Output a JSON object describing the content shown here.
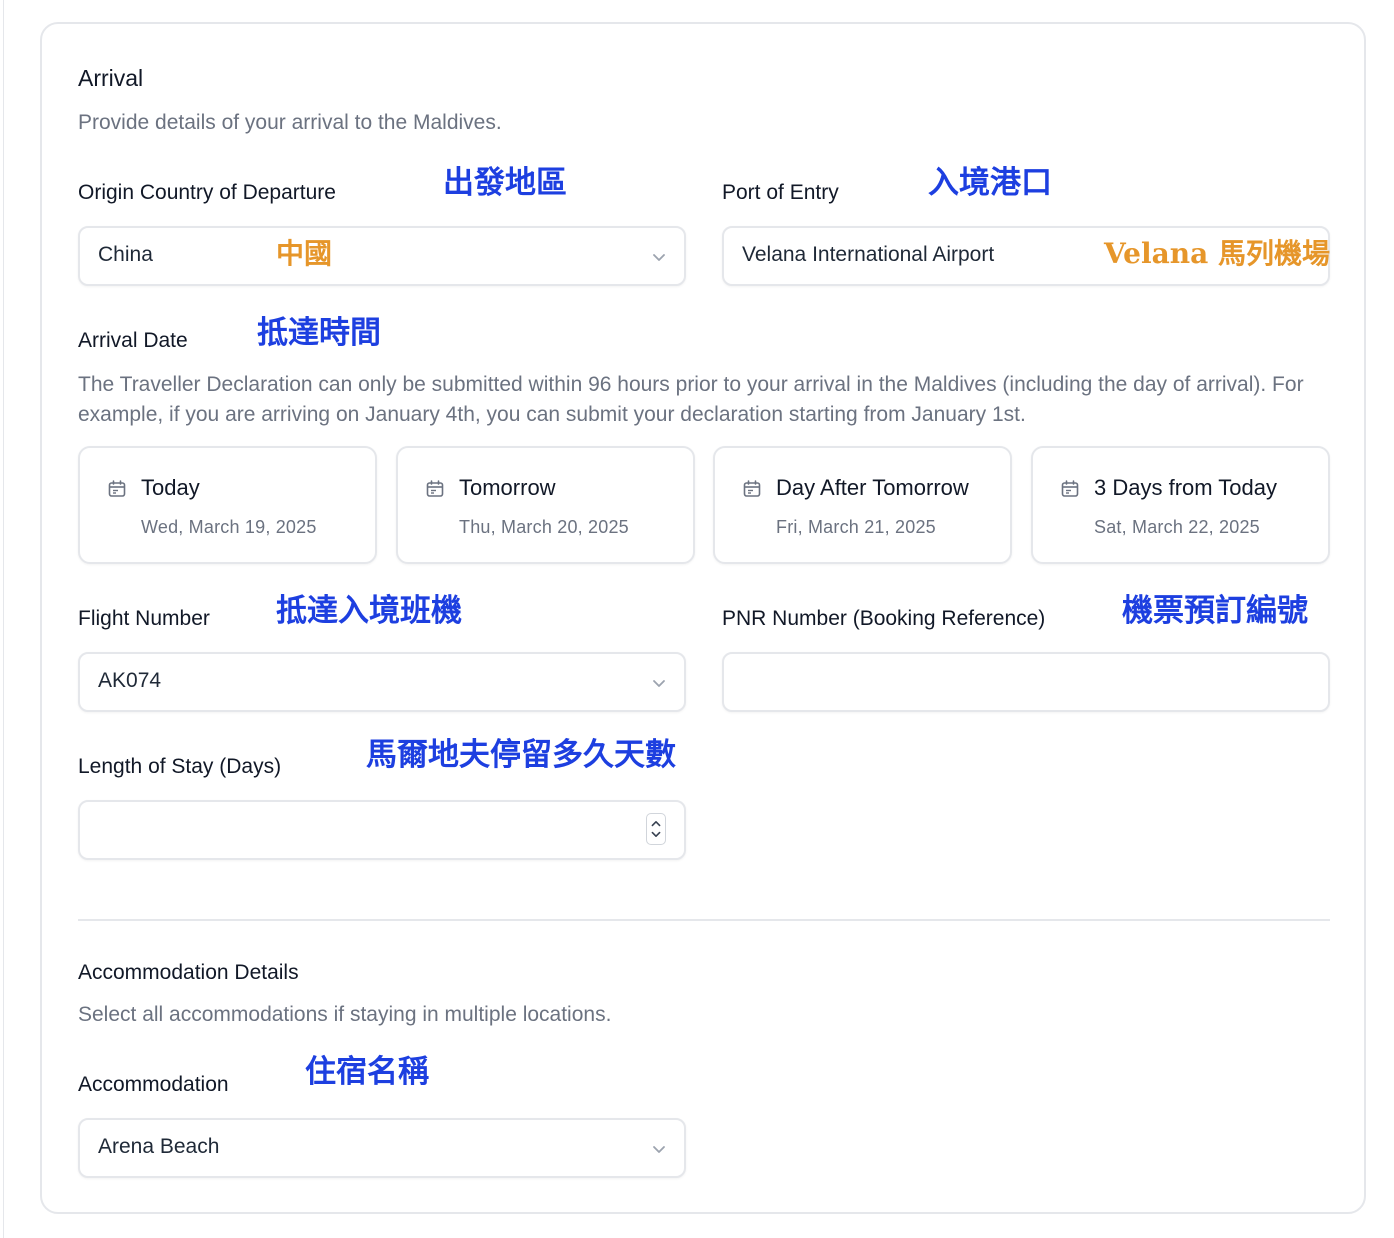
{
  "arrival": {
    "title": "Arrival",
    "subtitle": "Provide details of your arrival to the Maldives."
  },
  "origin": {
    "label": "Origin Country of Departure",
    "note": "出發地區",
    "value": "China",
    "value_note": "中國"
  },
  "port": {
    "label": "Port of Entry",
    "note": "入境港口",
    "value": "Velana International Airport",
    "value_note": "Velana 馬列機場"
  },
  "arrival_date": {
    "label": "Arrival Date",
    "note": "抵達時間",
    "description": "The Traveller Declaration can only be submitted within 96 hours prior to your arrival in the Maldives (including the day of arrival). For example, if you are arriving on January 4th, you can submit your declaration starting from January 1st.",
    "options": [
      {
        "label": "Today",
        "date": "Wed, March 19, 2025"
      },
      {
        "label": "Tomorrow",
        "date": "Thu, March 20, 2025"
      },
      {
        "label": "Day After Tomorrow",
        "date": "Fri, March 21, 2025"
      },
      {
        "label": "3 Days from Today",
        "date": "Sat, March 22, 2025"
      }
    ]
  },
  "flight": {
    "label": "Flight Number",
    "note": "抵達入境班機",
    "value": "AK074"
  },
  "pnr": {
    "label": "PNR Number (Booking Reference)",
    "note": "機票預訂編號",
    "value": ""
  },
  "stay": {
    "label": "Length of Stay (Days)",
    "note": "馬爾地夫停留多久天數",
    "value": ""
  },
  "accommodation_details": {
    "title": "Accommodation Details",
    "subtitle": "Select all accommodations if staying in multiple locations."
  },
  "accommodation": {
    "label": "Accommodation",
    "note": "住宿名稱",
    "value": "Arena Beach"
  },
  "icons": {
    "dropdown": "chevron-down-icon",
    "calendar": "calendar-icon",
    "stepper": "number-stepper-icon"
  },
  "colors": {
    "annotation_blue": "#1d3fe0",
    "annotation_orange": "#e6962a",
    "border": "#e5e7eb",
    "muted_text": "#6b7280"
  }
}
